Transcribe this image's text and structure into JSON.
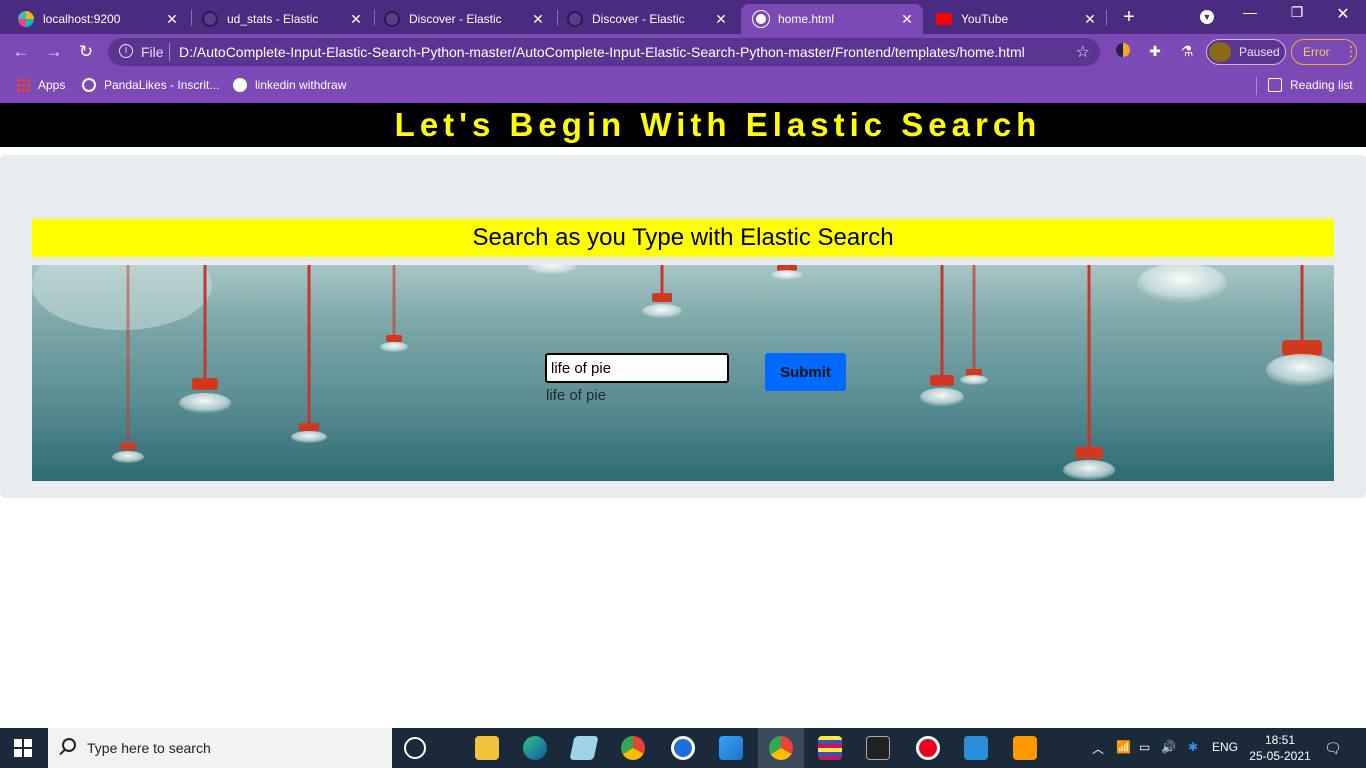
{
  "browser": {
    "tabs": [
      {
        "title": "localhost:9200",
        "favicon": "elastic-icon"
      },
      {
        "title": "ud_stats - Elastic",
        "favicon": "elastic-dark-icon"
      },
      {
        "title": "Discover - Elastic",
        "favicon": "elastic-dark-icon"
      },
      {
        "title": "Discover - Elastic",
        "favicon": "elastic-dark-icon"
      },
      {
        "title": "home.html",
        "favicon": "globe-icon",
        "active": true
      },
      {
        "title": "YouTube",
        "favicon": "youtube-icon"
      }
    ],
    "address": {
      "scheme_label": "File",
      "url": "D:/AutoComplete-Input-Elastic-Search-Python-master/AutoComplete-Input-Elastic-Search-Python-master/Frontend/templates/home.html"
    },
    "profile_status": "Paused",
    "error_label": "Error",
    "bookmarks": [
      {
        "label": "Apps",
        "icon": "apps-grid-icon"
      },
      {
        "label": "PandaLikes - Inscrit...",
        "icon": "pandalikes-icon"
      },
      {
        "label": "linkedin withdraw",
        "icon": "globe-icon"
      }
    ],
    "reading_list": "Reading list"
  },
  "page": {
    "header": "Let's Begin With Elastic Search",
    "subtitle": "Search as you Type with Elastic Search",
    "search": {
      "value": "life of pie",
      "suggestion": "life of pie"
    },
    "submit_label": "Submit"
  },
  "taskbar": {
    "search_placeholder": "Type here to search",
    "language": "ENG",
    "time": "18:51",
    "date": "25-05-2021"
  },
  "colors": {
    "header_bg": "#000000",
    "header_text": "#ffff00",
    "subtitle_bg": "#ffff00",
    "submit_bg": "#0069ff",
    "chrome_purple": "#7b4ab5"
  }
}
